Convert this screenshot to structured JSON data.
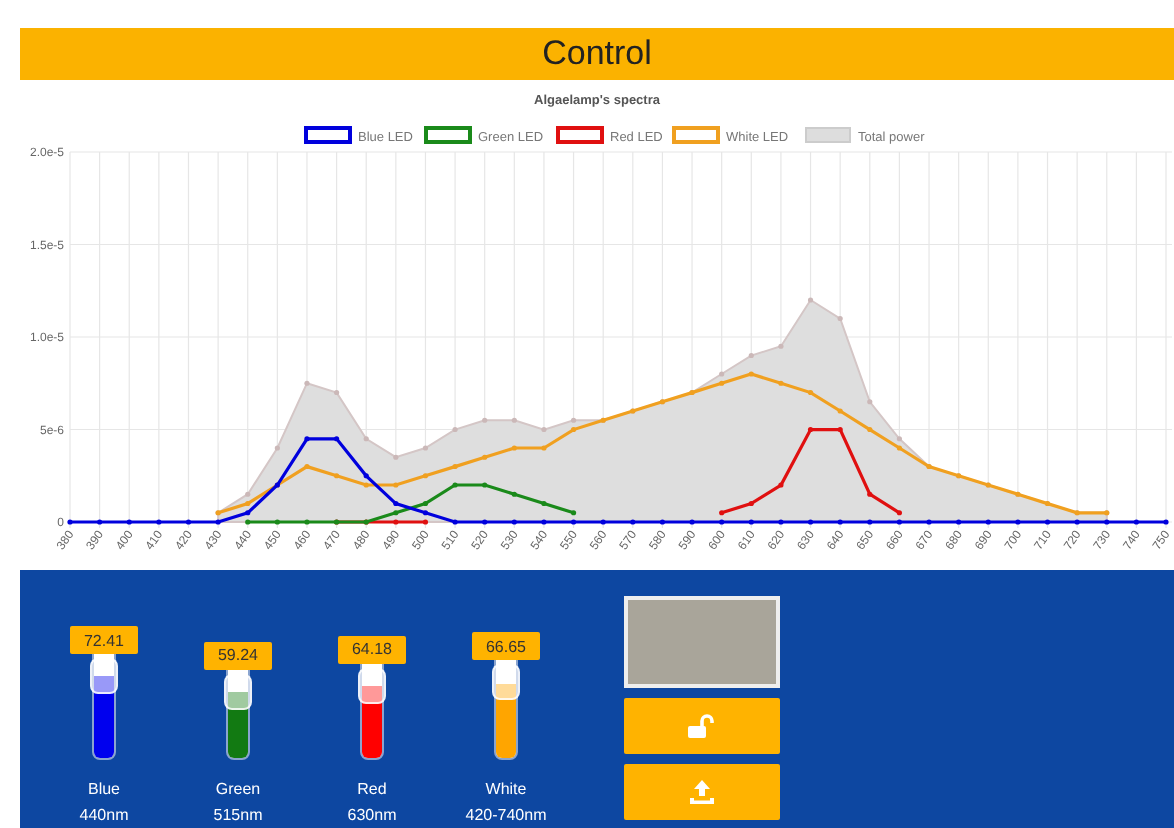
{
  "header": {
    "title": "Control"
  },
  "chart": {
    "chart_data": {
      "type": "line",
      "title": "Algaelamp's spectra",
      "grid": true,
      "legend": true,
      "x": [
        380,
        390,
        400,
        410,
        420,
        430,
        440,
        450,
        460,
        470,
        480,
        490,
        500,
        510,
        520,
        530,
        540,
        550,
        560,
        570,
        580,
        590,
        600,
        610,
        620,
        630,
        640,
        650,
        660,
        670,
        680,
        690,
        700,
        710,
        720,
        730,
        740,
        750
      ],
      "ylim": [
        0,
        2e-05
      ],
      "yticks": [
        {
          "value": 0,
          "label": "0"
        },
        {
          "value": 5e-06,
          "label": "5e-6"
        },
        {
          "value": 1e-05,
          "label": "1.0e-5"
        },
        {
          "value": 1.5e-05,
          "label": "1.5e-5"
        },
        {
          "value": 2e-05,
          "label": "2.0e-5"
        }
      ],
      "series": [
        {
          "name": "Blue LED",
          "color": "#0000dd",
          "values": [
            0,
            0,
            0,
            0,
            0,
            0,
            5e-07,
            2e-06,
            4.5e-06,
            4.5e-06,
            2.5e-06,
            1e-06,
            5e-07,
            0,
            0,
            0,
            0,
            0,
            0,
            0,
            0,
            0,
            0,
            0,
            0,
            0,
            0,
            0,
            0,
            0,
            0,
            0,
            0,
            0,
            0,
            0,
            0,
            0
          ]
        },
        {
          "name": "Green LED",
          "color": "#1a8a1a",
          "values": [
            null,
            null,
            null,
            null,
            null,
            null,
            0,
            0,
            0,
            0,
            0,
            5e-07,
            1e-06,
            2e-06,
            2e-06,
            1.5e-06,
            1e-06,
            5e-07,
            null,
            null,
            null,
            null,
            null,
            null,
            null,
            null,
            null,
            null,
            null,
            null,
            null,
            null,
            null,
            null,
            null,
            null,
            null,
            null
          ]
        },
        {
          "name": "Red LED",
          "color": "#e01010",
          "values": [
            null,
            null,
            null,
            null,
            null,
            null,
            null,
            null,
            null,
            0,
            0,
            0,
            0,
            null,
            null,
            null,
            null,
            null,
            null,
            null,
            null,
            null,
            5e-07,
            1e-06,
            2e-06,
            5e-06,
            5e-06,
            1.5e-06,
            5e-07,
            null,
            null,
            null,
            null,
            null,
            null,
            null,
            null,
            null
          ]
        },
        {
          "name": "White LED",
          "color": "#f0a020",
          "values": [
            null,
            null,
            null,
            null,
            null,
            5e-07,
            1e-06,
            2e-06,
            3e-06,
            2.5e-06,
            2e-06,
            2e-06,
            2.5e-06,
            3e-06,
            3.5e-06,
            4e-06,
            4e-06,
            5e-06,
            5.5e-06,
            6e-06,
            6.5e-06,
            7e-06,
            7.5e-06,
            8e-06,
            7.5e-06,
            7e-06,
            6e-06,
            5e-06,
            4e-06,
            3e-06,
            2.5e-06,
            2e-06,
            1.5e-06,
            1e-06,
            5e-07,
            5e-07,
            null,
            null
          ]
        },
        {
          "name": "Total power",
          "color": "#cccccc",
          "type": "area",
          "values": [
            null,
            null,
            null,
            null,
            null,
            5e-07,
            1.5e-06,
            4e-06,
            7.5e-06,
            7e-06,
            4.5e-06,
            3.5e-06,
            4e-06,
            5e-06,
            5.5e-06,
            5.5e-06,
            5e-06,
            5.5e-06,
            5.5e-06,
            6e-06,
            6.5e-06,
            7e-06,
            8e-06,
            9e-06,
            9.5e-06,
            1.2e-05,
            1.1e-05,
            6.5e-06,
            4.5e-06,
            3e-06,
            2.5e-06,
            2e-06,
            1.5e-06,
            1e-06,
            5e-07,
            5e-07,
            null,
            null
          ]
        }
      ]
    }
  },
  "sliders": [
    {
      "name": "Blue",
      "wavelength": "440nm",
      "value": "72.41",
      "level": 0.7241,
      "color": "#0000ee"
    },
    {
      "name": "Green",
      "wavelength": "515nm",
      "value": "59.24",
      "level": 0.5924,
      "color": "#127a12"
    },
    {
      "name": "Red",
      "wavelength": "630nm",
      "value": "64.18",
      "level": 0.6418,
      "color": "#ff0000"
    },
    {
      "name": "White",
      "wavelength": "420-740nm",
      "value": "66.65",
      "level": 0.6665,
      "color": "#ffa500"
    }
  ],
  "preview": {
    "color": "#a9a59a"
  },
  "buttons": [
    {
      "kind": "unlock"
    },
    {
      "kind": "upload"
    }
  ]
}
